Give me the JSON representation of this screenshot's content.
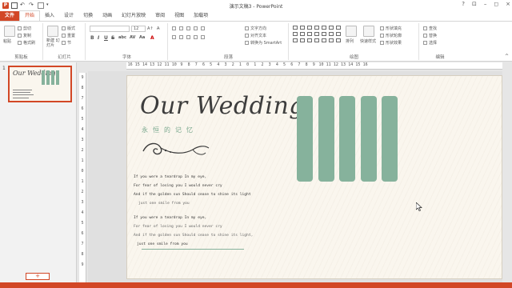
{
  "titlebar": {
    "title": "演示文稿3 - PowerPoint",
    "logo": "P",
    "buttons": [
      "?",
      "⊡",
      "–",
      "◻",
      "×"
    ]
  },
  "tabs": [
    "文件",
    "开始",
    "插入",
    "设计",
    "切换",
    "动画",
    "幻灯片放映",
    "审阅",
    "视图",
    "加载项"
  ],
  "ribbon": {
    "clipboard": {
      "label": "剪贴板",
      "paste": "粘贴",
      "cut": "剪切",
      "copy": "复制",
      "format_painter": "格式刷"
    },
    "slides": {
      "label": "幻灯片",
      "new_slide": "新建\n幻灯片",
      "layout": "版式",
      "reset": "重置",
      "section": "节"
    },
    "font": {
      "label": "字体",
      "font_name": "",
      "font_size": "12",
      "bold": "B",
      "italic": "I",
      "underline": "U",
      "strike": "S",
      "shadow": "abc",
      "spacing": "AV",
      "case": "Aa"
    },
    "paragraph": {
      "label": "段落",
      "text_direction": "文字方向",
      "align_text": "对齐文本",
      "smartart": "转换为 SmartArt"
    },
    "drawing": {
      "label": "绘图",
      "arrange": "排列",
      "quick_styles": "快速样式",
      "shape_fill": "形状填充",
      "shape_outline": "形状轮廓",
      "shape_effects": "形状效果"
    },
    "editing": {
      "label": "编辑",
      "find": "查找",
      "replace": "替换",
      "select": "选择"
    }
  },
  "thumbnails": [
    {
      "number": "1",
      "title": "Our Wedding"
    }
  ],
  "ruler": {
    "h": [
      "16",
      "15",
      "14",
      "13",
      "12",
      "11",
      "10",
      "9",
      "8",
      "7",
      "6",
      "5",
      "4",
      "3",
      "2",
      "1",
      "0",
      "1",
      "2",
      "3",
      "4",
      "5",
      "6",
      "7",
      "8",
      "9",
      "10",
      "11",
      "12",
      "13",
      "14",
      "15",
      "16"
    ],
    "v": [
      "9",
      "8",
      "7",
      "6",
      "5",
      "4",
      "3",
      "2",
      "1",
      "0",
      "1",
      "2",
      "3",
      "4",
      "5",
      "6",
      "7",
      "8",
      "9"
    ]
  },
  "slide": {
    "title": "Our Wedding",
    "subtitle": "永恒的记忆",
    "bar_color": "#86b29c",
    "poem": [
      {
        "text": "If you were a teardrop In my eye,",
        "style": "dark"
      },
      {
        "text": "For fear of losing you I would never cry",
        "style": "dark"
      },
      {
        "text": "And if the golden sun Should cease to shine its light",
        "style": "dark"
      },
      {
        "text": "just one smile from you",
        "style": "light"
      },
      {
        "text": "",
        "style": "dark"
      },
      {
        "text": "If you were a teardrop In my eye,",
        "style": "dark"
      },
      {
        "text": "For fear of losing you I would never cry",
        "style": "light"
      },
      {
        "text": "And if the golden sun Should cease to shine its light,",
        "style": "light"
      },
      {
        "text": "just one smile from you",
        "style": "dark"
      }
    ]
  },
  "thumbpane": {
    "add_label": "+"
  },
  "colors": {
    "accent": "#d24726",
    "green": "#86b29c"
  }
}
